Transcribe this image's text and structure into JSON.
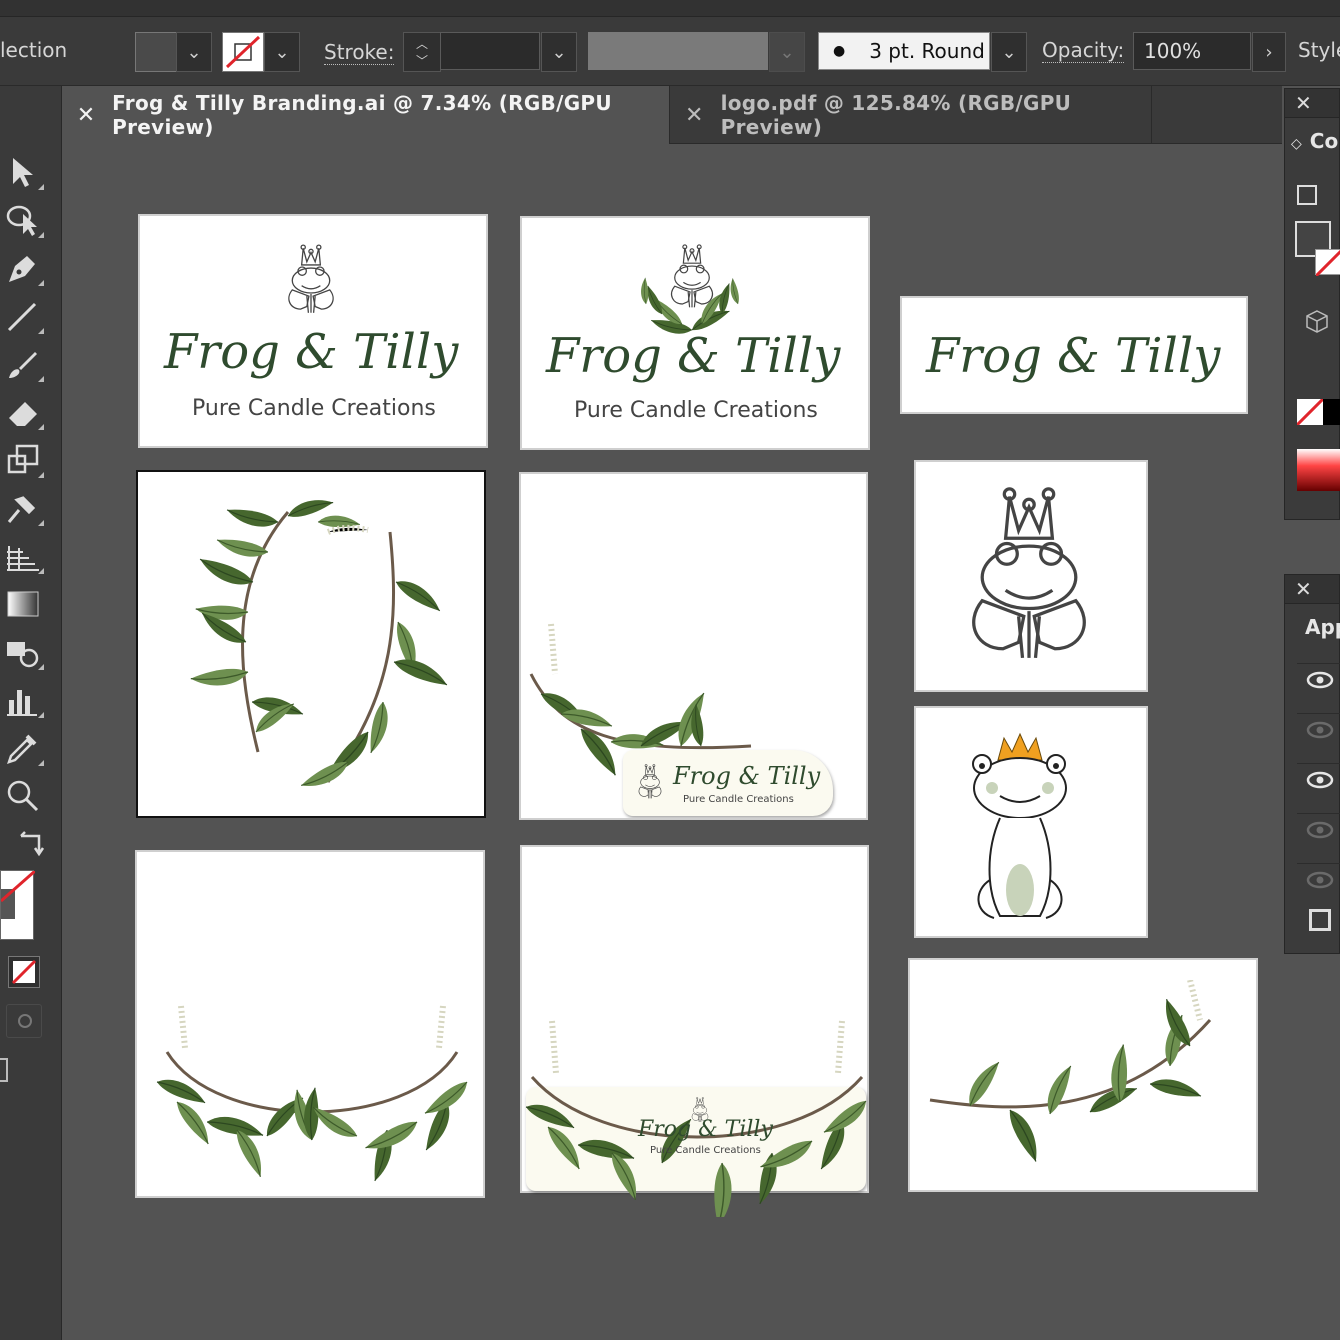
{
  "control_bar": {
    "selection_label": "lection",
    "stroke_label": "Stroke:",
    "brush_value": "3 pt. Round",
    "opacity_label": "Opacity:",
    "opacity_value": "100%",
    "style_label": "Style"
  },
  "tabs": [
    {
      "label": "Frog & Tilly Branding.ai @ 7.34% (RGB/GPU Preview)",
      "active": true
    },
    {
      "label": "logo.pdf @ 125.84% (RGB/GPU Preview)",
      "active": false
    }
  ],
  "panels": {
    "color_title": "Co",
    "appearance_title": "App"
  },
  "artboards": {
    "brand_name": "Frog & Tilly",
    "tagline": "Pure Candle Creations"
  },
  "colors": {
    "ui_bg": "#535353",
    "panel_bg": "#3a3a3a",
    "leaf_green": "#5d7f3e",
    "script_green": "#2f4b2e",
    "crown_orange": "#f0a020"
  },
  "icons": {
    "tools": [
      "selection-arrow-icon",
      "lasso-icon",
      "pen-icon",
      "line-icon",
      "brush-icon",
      "eraser-icon",
      "scale-icon",
      "pin-icon",
      "perspective-grid-icon",
      "gradient-icon",
      "shape-builder-icon",
      "graph-icon",
      "eyedropper-icon",
      "zoom-icon",
      "swap-icon"
    ]
  }
}
